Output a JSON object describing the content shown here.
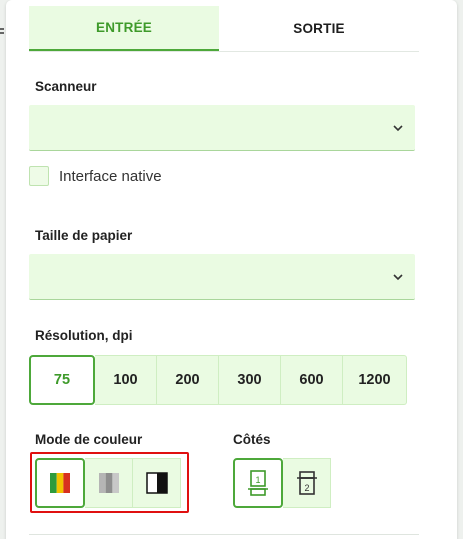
{
  "tabs": [
    {
      "label": "ENTRÉE",
      "active": true
    },
    {
      "label": "SORTIE",
      "active": false
    }
  ],
  "scanner": {
    "label": "Scanneur",
    "value": ""
  },
  "native_interface": {
    "label": "Interface native",
    "checked": false
  },
  "paper_size": {
    "label": "Taille de papier",
    "value": ""
  },
  "resolution": {
    "label": "Résolution, dpi",
    "options": [
      "75",
      "100",
      "200",
      "300",
      "600",
      "1200"
    ],
    "selected": "75"
  },
  "color_mode": {
    "label": "Mode de couleur",
    "options": [
      {
        "icon": "color-mode-icon",
        "selected": true
      },
      {
        "icon": "grayscale-mode-icon",
        "selected": false
      },
      {
        "icon": "black-white-mode-icon",
        "selected": false
      }
    ]
  },
  "sides": {
    "label": "Côtés",
    "options": [
      {
        "icon": "single-side-icon",
        "text": "1",
        "selected": true
      },
      {
        "icon": "double-side-icon",
        "text": "2",
        "selected": false
      }
    ]
  },
  "colors": {
    "accent": "#4da83a",
    "accent_text": "#3e9a2a",
    "field_bg": "#eafbe2",
    "highlight": "#e01010"
  }
}
